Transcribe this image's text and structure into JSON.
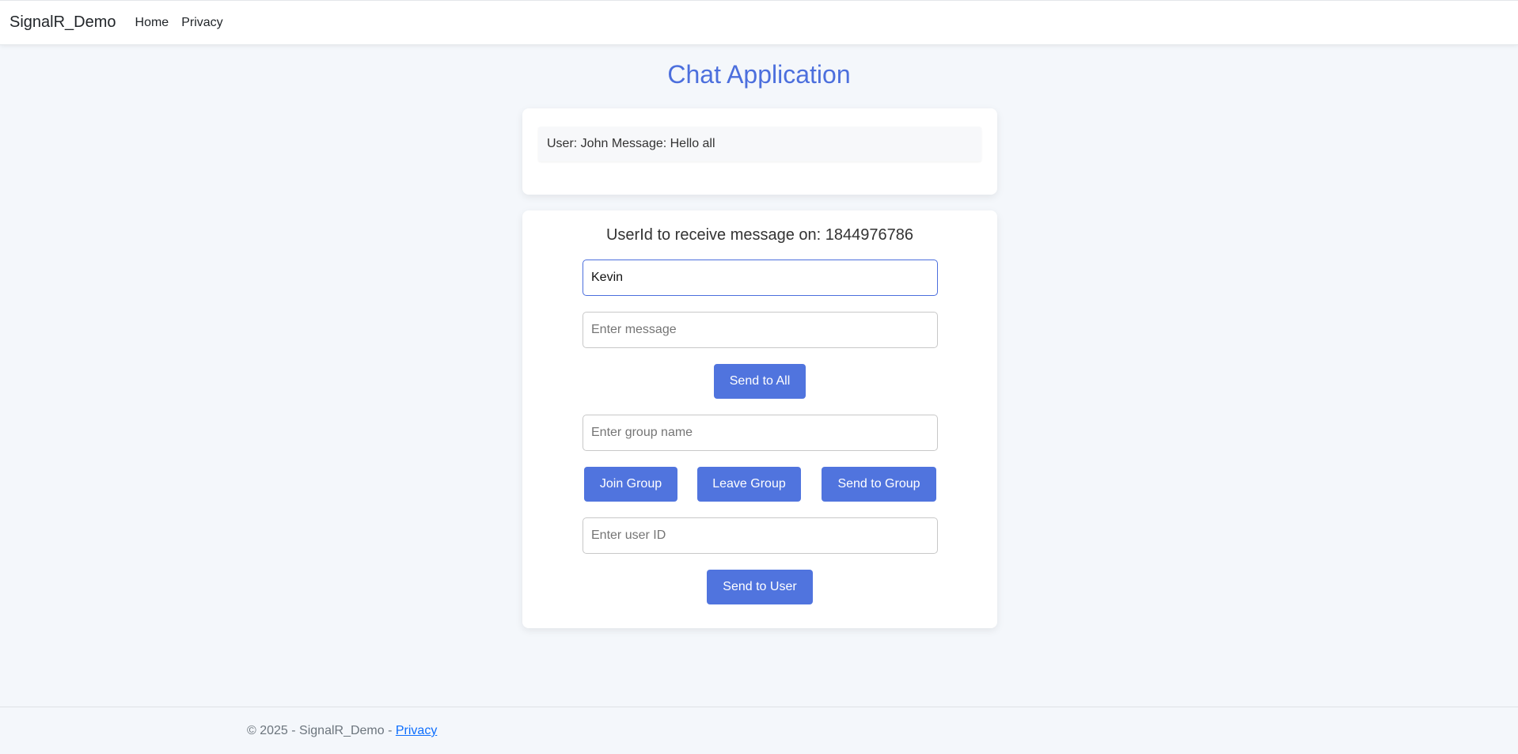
{
  "navbar": {
    "brand": "SignalR_Demo",
    "links": [
      "Home",
      "Privacy"
    ]
  },
  "page": {
    "title": "Chat Application"
  },
  "messages": [
    "User: John Message: Hello all"
  ],
  "controls": {
    "userid_label": "UserId to receive message on: 1844976786",
    "user_name": {
      "value": "Kevin",
      "placeholder": ""
    },
    "message": {
      "value": "",
      "placeholder": "Enter message"
    },
    "send_all_label": "Send to All",
    "group_name": {
      "value": "",
      "placeholder": "Enter group name"
    },
    "join_group_label": "Join Group",
    "leave_group_label": "Leave Group",
    "send_group_label": "Send to Group",
    "user_id": {
      "value": "",
      "placeholder": "Enter user ID"
    },
    "send_user_label": "Send to User"
  },
  "footer": {
    "copyright": "© 2025 - SignalR_Demo - ",
    "privacy_link": "Privacy"
  },
  "colors": {
    "accent": "#4c6fdd",
    "button": "#5074de",
    "background": "#f4f7fb"
  }
}
